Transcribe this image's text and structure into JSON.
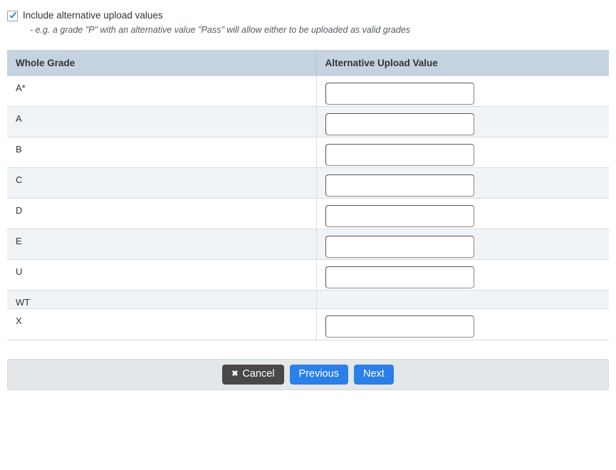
{
  "intro": {
    "checkbox_checked": true,
    "checkbox_label": "Include alternative upload values",
    "note": "- e.g. a grade \"P\" with an alternative value \"Pass\" will allow either to be uploaded as valid grades"
  },
  "table": {
    "headers": {
      "grade": "Whole Grade",
      "alternative": "Alternative Upload Value"
    },
    "rows": [
      {
        "grade": "A*",
        "value": "",
        "has_input": true
      },
      {
        "grade": "A",
        "value": "",
        "has_input": true
      },
      {
        "grade": "B",
        "value": "",
        "has_input": true
      },
      {
        "grade": "C",
        "value": "",
        "has_input": true
      },
      {
        "grade": "D",
        "value": "",
        "has_input": true
      },
      {
        "grade": "E",
        "value": "",
        "has_input": true
      },
      {
        "grade": "U",
        "value": "",
        "has_input": true
      },
      {
        "grade": "WT",
        "value": "",
        "has_input": false
      },
      {
        "grade": "X",
        "value": "",
        "has_input": true
      }
    ]
  },
  "footer": {
    "cancel_label": "Cancel",
    "cancel_icon": "close-x-icon",
    "previous_label": "Previous",
    "next_label": "Next"
  },
  "colors": {
    "header_bg": "#c5d3e0",
    "alt_row_bg": "#f0f4f7",
    "footer_bg": "#e3e7e9",
    "primary_button": "#2a7fe8",
    "cancel_button": "#484848",
    "checkbox_check": "#1a73d0"
  }
}
